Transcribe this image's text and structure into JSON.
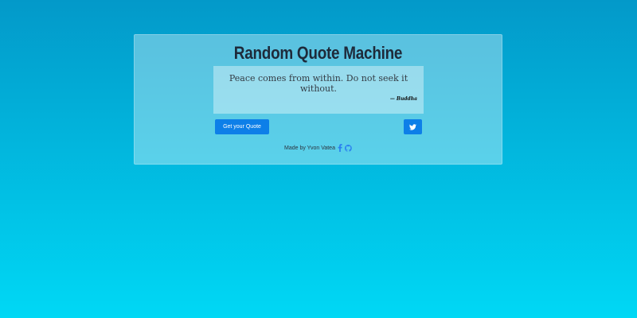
{
  "header": {
    "title": "Random Quote Machine"
  },
  "quote": {
    "text": "Peace comes from within. Do not seek it without.",
    "author": "— Buddha"
  },
  "actions": {
    "new_quote_label": "Get your Quote",
    "tweet_icon": "twitter-icon"
  },
  "footer": {
    "credit": "Made by Yvon Vatea",
    "icons": [
      "facebook-icon",
      "github-icon"
    ]
  },
  "colors": {
    "gradient_top": "#0399c9",
    "gradient_bottom": "#00d8f5",
    "button": "#0d7fe8",
    "title": "#1e2a3a",
    "icon_link": "#2a7ff0"
  }
}
